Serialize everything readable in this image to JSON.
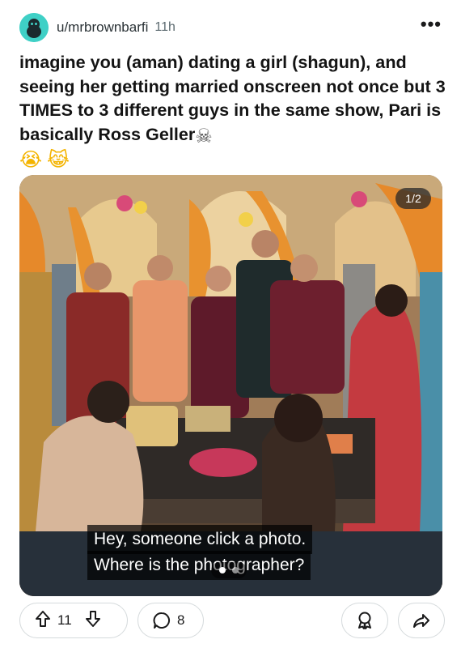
{
  "post": {
    "username": "u/mrbrownbarfi",
    "age": "11h",
    "more_label": "•••",
    "title": "imagine you (aman) dating a girl (shagun), and seeing her getting married onscreen not once but 3 TIMES to 3 different guys in the same show, Pari is basically Ross Geller",
    "emojis": {
      "skull": "☠",
      "cry": "😭",
      "laugh": "😹"
    }
  },
  "media": {
    "counter": "1/2",
    "caption_line1": "Hey, someone click a photo.",
    "caption_line2": "Where is the photographer?",
    "slide_count": 2,
    "active_slide": 1
  },
  "actions": {
    "upvotes": "11",
    "comments": "8"
  },
  "colors": {
    "avatar": "#3fd0c6",
    "border": "#d5dadc",
    "text": "#111418"
  },
  "icons": [
    "reddit-avatar-icon",
    "more-options-icon",
    "upvote-icon",
    "downvote-icon",
    "comment-icon",
    "award-icon",
    "share-icon"
  ]
}
